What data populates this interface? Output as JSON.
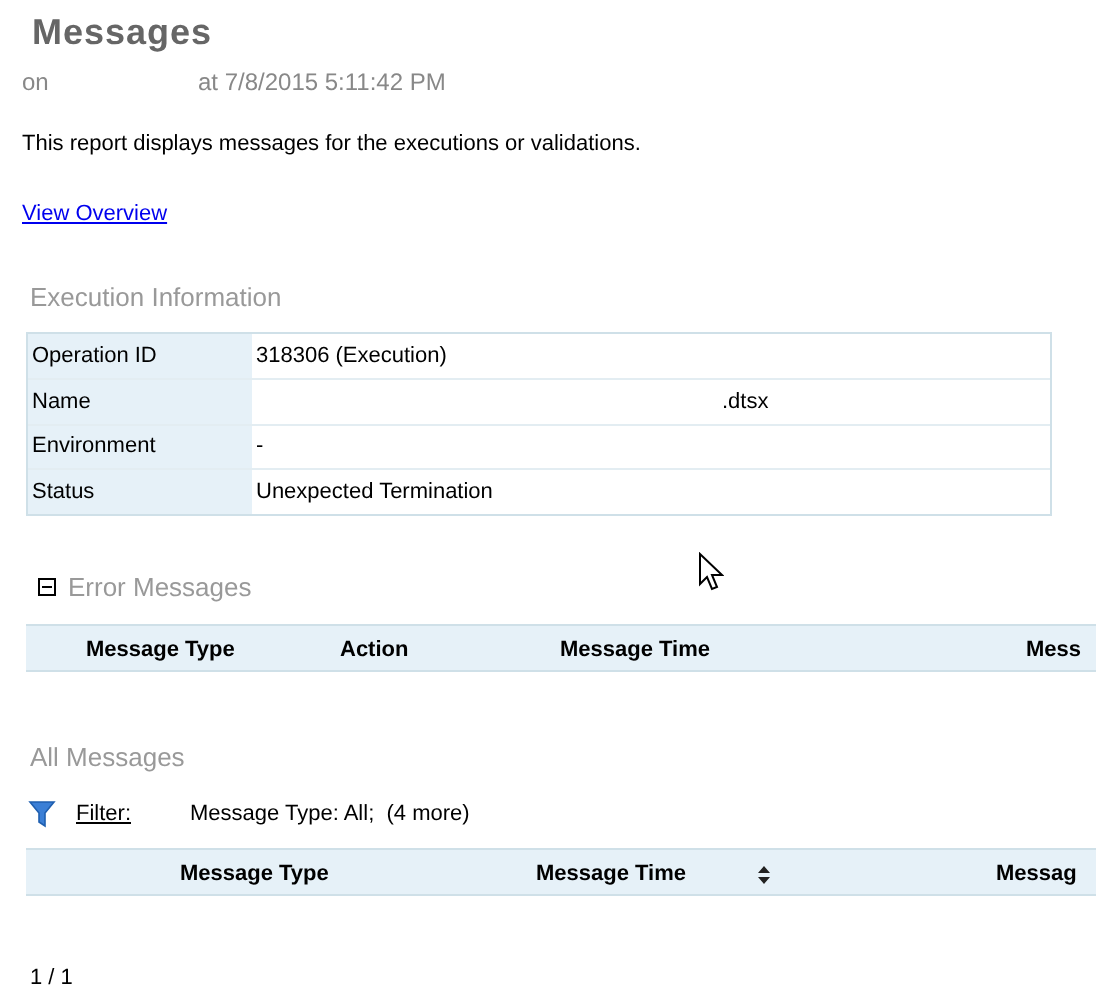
{
  "title": "Messages",
  "subtitle": {
    "prefix": "on",
    "timestamp": "at 7/8/2015 5:11:42 PM"
  },
  "description": "This report displays messages for the executions or validations.",
  "overview_link": "View Overview",
  "execution_information": {
    "heading": "Execution Information",
    "rows": [
      {
        "label": "Operation ID",
        "value": "318306 (Execution)"
      },
      {
        "label": "Name",
        "value": ".dtsx"
      },
      {
        "label": "Environment",
        "value": "-"
      },
      {
        "label": "Status",
        "value": "Unexpected Termination"
      }
    ]
  },
  "error_messages": {
    "heading": "Error Messages",
    "expanded": true,
    "columns": [
      "Message Type",
      "Action",
      "Message Time",
      "Mess"
    ]
  },
  "all_messages": {
    "heading": "All Messages",
    "filter_label": "Filter:",
    "filter_value": "Message Type: All;  (4 more)",
    "columns": [
      {
        "label": "Message Type",
        "sortable": false
      },
      {
        "label": "Message Time",
        "sortable": true
      },
      {
        "label": "Messag",
        "sortable": false
      }
    ]
  },
  "pager": "1 / 1"
}
